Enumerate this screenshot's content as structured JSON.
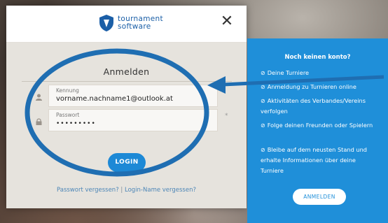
{
  "dialog": {
    "logo_line1": "tournament",
    "logo_line2": "software",
    "close_symbol": "✕",
    "title": "Anmelden",
    "username": {
      "label": "Kennung",
      "value": "vorname.nachname1@outlook.at"
    },
    "password": {
      "label": "Passwort",
      "value": "•••••••••"
    },
    "required_marker": "*",
    "login_button": "LOGIN",
    "forgot_password": "Passwort vergessen?",
    "link_separator": " | ",
    "forgot_login": "Login-Name vergessen?"
  },
  "panel": {
    "title": "Noch keinen konto?",
    "check_symbol": "⊘",
    "items": [
      "Deine Turniere",
      "Anmeldung zu Turnieren online",
      "Aktivitäten des Verbandes/Vereins verfolgen",
      "Folge deinen Freunden oder Spielern",
      "Bleibe auf dem neusten Stand und erhalte Informationen über deine Turniere"
    ],
    "button": "ANMELDEN"
  },
  "colors": {
    "brand_blue": "#1d89d6",
    "panel_blue": "#1f8fd9",
    "annotation_blue": "#1f6eb2",
    "dialog_body": "#e6e3dd"
  },
  "icons": {
    "logo": "shield-icon",
    "close": "close-icon",
    "user": "user-icon",
    "password": "lock-icon",
    "check": "check-circle-icon"
  }
}
